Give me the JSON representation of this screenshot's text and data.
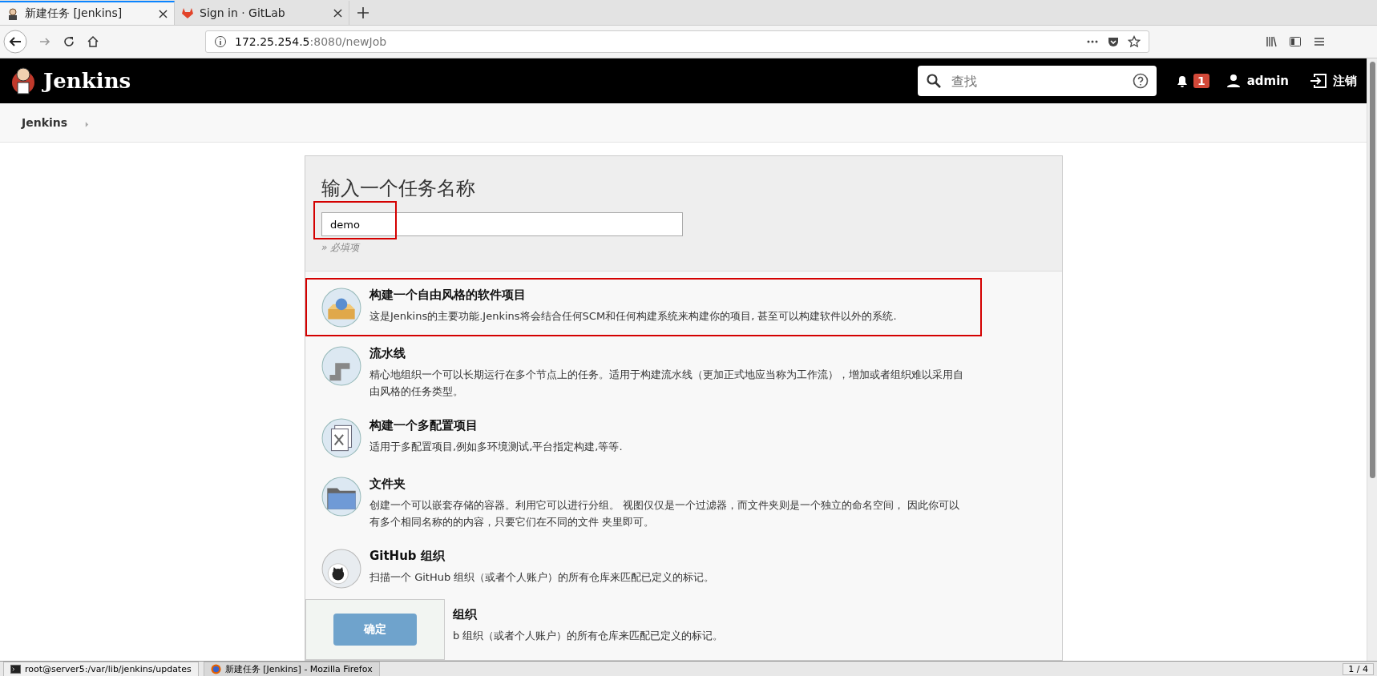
{
  "browser": {
    "tabs": [
      {
        "title": "新建任务 [Jenkins]",
        "kind": "jenkins",
        "selected": true
      },
      {
        "title": "Sign in · GitLab",
        "kind": "gitlab",
        "selected": false
      }
    ],
    "url": {
      "host": "172.25.254.5",
      "path": ":8080/newJob"
    }
  },
  "header": {
    "logo": "Jenkins",
    "search": {
      "placeholder": "查找"
    },
    "notifications": "1",
    "user": "admin",
    "logout": "注销"
  },
  "breadcrumb": [
    "Jenkins"
  ],
  "form": {
    "heading": "输入一个任务名称",
    "name_field": {
      "value": "demo",
      "highlighted": true
    },
    "required_note": "» 必填项"
  },
  "items": [
    {
      "kind": "freestyle",
      "title": "构建一个自由风格的软件项目",
      "description": "这是Jenkins的主要功能.Jenkins将会结合任何SCM和任何构建系统来构建你的项目, 甚至可以构建软件以外的系统.",
      "highlighted": true
    },
    {
      "kind": "pipeline",
      "title": "流水线",
      "description": "精心地组织一个可以长期运行在多个节点上的任务。适用于构建流水线（更加正式地应当称为工作流），增加或者组织难以采用自由风格的任务类型。",
      "highlighted": false
    },
    {
      "kind": "multiconfig",
      "title": "构建一个多配置项目",
      "description": "适用于多配置项目,例如多环境测试,平台指定构建,等等.",
      "highlighted": false
    },
    {
      "kind": "folder",
      "title": "文件夹",
      "description": "创建一个可以嵌套存储的容器。利用它可以进行分组。 视图仅仅是一个过滤器，而文件夹则是一个独立的命名空间， 因此你可以有多个相同名称的的内容，只要它们在不同的文件 夹里即可。",
      "highlighted": false
    },
    {
      "kind": "github",
      "title": "GitHub 组织",
      "description": "扫描一个 GitHub 组织（或者个人账户）的所有仓库来匹配已定义的标记。",
      "highlighted": false
    },
    {
      "covered": true,
      "title": "组织",
      "description": "b 组织（或者个人账户）的所有仓库来匹配已定义的标记。",
      "highlighted": false
    }
  ],
  "ok_button": "确定",
  "taskbar": {
    "windows": [
      {
        "label": "root@server5:/var/lib/jenkins/updates",
        "kind": "terminal",
        "selected": false
      },
      {
        "label": "新建任务 [Jenkins] - Mozilla Firefox",
        "kind": "firefox",
        "selected": true
      }
    ],
    "pager": "1 / 4"
  }
}
